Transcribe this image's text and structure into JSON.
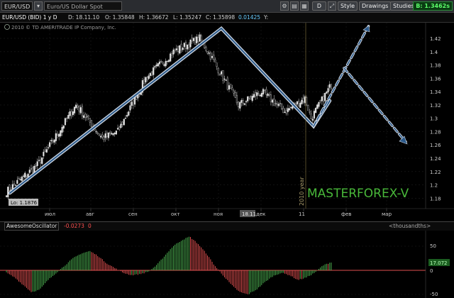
{
  "toolbar": {
    "symbol": "EUR/USD",
    "symbol_description": "Euro/US Dollar Spot",
    "timeframe": "D",
    "style_label": "Style",
    "drawings_label": "Drawings",
    "studies_label": "Studies",
    "bid": "B: 1.3462s"
  },
  "info": {
    "series": "EUR/USD (BID) 1 y D",
    "date": "D: 18.11.10",
    "open": "O: 1.35848",
    "high": "H: 1.36672",
    "low": "L: 1.35247",
    "close": "C: 1.35898",
    "change": "0.01425",
    "y_label": "Y:"
  },
  "copyright": "2010 © TD AMERITRADE IP Company, Inc.",
  "watermark": "MASTERFOREX-V",
  "year_marker": "2010 year",
  "low_label": "Lo: 1.1876",
  "cursor_date": "18.11",
  "price_axis": [
    "1.42",
    "1.4",
    "1.38",
    "1.36",
    "1.34",
    "1.32",
    "1.3",
    "1.28",
    "1.26",
    "1.24",
    "1.22",
    "1.2",
    "1.18"
  ],
  "time_axis": [
    "июл",
    "авг",
    "сен",
    "окт",
    "ноя",
    "дек",
    "11",
    "фев",
    "мар"
  ],
  "oscillator": {
    "title": "AwesomeOscillator",
    "value": "-0.0273",
    "settings": "<thousandths>",
    "axis": [
      "50",
      "0",
      "-50"
    ],
    "current": "17.072"
  },
  "colors": {
    "up_bar": "#4caf50",
    "down_bar": "#e05050",
    "trendline": "#2c5a8a",
    "watermark": "#49b83a",
    "bid_bg": "#0a3b12"
  },
  "chart_data": {
    "type": "candlestick",
    "title": "EUR/USD (BID) 1 y D",
    "ylim": [
      1.175,
      1.435
    ],
    "anchors": [
      {
        "t": 0,
        "price": 1.19
      },
      {
        "t": 20,
        "price": 1.23
      },
      {
        "t": 45,
        "price": 1.32
      },
      {
        "t": 52,
        "price": 1.3
      },
      {
        "t": 62,
        "price": 1.27
      },
      {
        "t": 72,
        "price": 1.28
      },
      {
        "t": 90,
        "price": 1.36
      },
      {
        "t": 108,
        "price": 1.4
      },
      {
        "t": 125,
        "price": 1.42
      },
      {
        "t": 133,
        "price": 1.39
      },
      {
        "t": 150,
        "price": 1.32
      },
      {
        "t": 165,
        "price": 1.34
      },
      {
        "t": 180,
        "price": 1.31
      },
      {
        "t": 193,
        "price": 1.33
      },
      {
        "t": 197,
        "price": 1.3
      },
      {
        "t": 210,
        "price": 1.35
      }
    ],
    "oscillator_values": [
      -5,
      -15,
      -30,
      -45,
      -40,
      -20,
      -5,
      10,
      25,
      35,
      40,
      30,
      15,
      5,
      -5,
      -10,
      -8,
      -3,
      10,
      30,
      50,
      62,
      70,
      55,
      35,
      10,
      -10,
      -30,
      -45,
      -50,
      -40,
      -25,
      -12,
      -5,
      -10,
      -20,
      -15,
      -5,
      10,
      17
    ]
  }
}
